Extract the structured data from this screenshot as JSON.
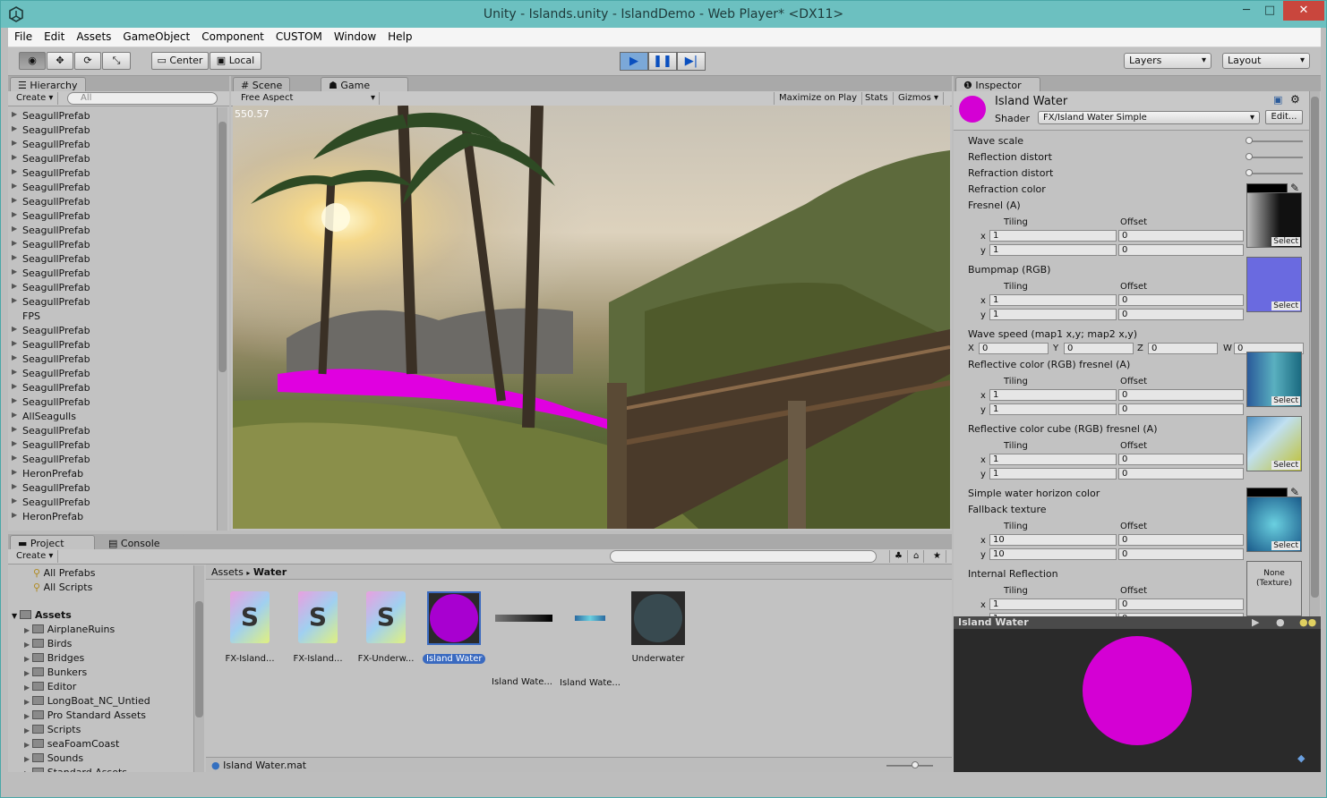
{
  "window": {
    "title": "Unity - Islands.unity - IslandDemo - Web Player* <DX11>",
    "controls": [
      "─",
      "□",
      "✕"
    ]
  },
  "menu": [
    "File",
    "Edit",
    "Assets",
    "GameObject",
    "Component",
    "CUSTOM",
    "Window",
    "Help"
  ],
  "toolbar": {
    "pivot": "Center",
    "space": "Local",
    "layers": "Layers",
    "layout": "Layout"
  },
  "hierarchy": {
    "tab": "Hierarchy",
    "create": "Create",
    "search_placeholder": "All",
    "items": [
      {
        "label": "SeagullPrefab",
        "arrow": true
      },
      {
        "label": "SeagullPrefab",
        "arrow": true
      },
      {
        "label": "SeagullPrefab",
        "arrow": true
      },
      {
        "label": "SeagullPrefab",
        "arrow": true
      },
      {
        "label": "SeagullPrefab",
        "arrow": true
      },
      {
        "label": "SeagullPrefab",
        "arrow": true
      },
      {
        "label": "SeagullPrefab",
        "arrow": true
      },
      {
        "label": "SeagullPrefab",
        "arrow": true
      },
      {
        "label": "SeagullPrefab",
        "arrow": true
      },
      {
        "label": "SeagullPrefab",
        "arrow": true
      },
      {
        "label": "SeagullPrefab",
        "arrow": true
      },
      {
        "label": "SeagullPrefab",
        "arrow": true
      },
      {
        "label": "SeagullPrefab",
        "arrow": true
      },
      {
        "label": "SeagullPrefab",
        "arrow": true
      },
      {
        "label": "FPS",
        "arrow": false
      },
      {
        "label": "SeagullPrefab",
        "arrow": true
      },
      {
        "label": "SeagullPrefab",
        "arrow": true
      },
      {
        "label": "SeagullPrefab",
        "arrow": true
      },
      {
        "label": "SeagullPrefab",
        "arrow": true
      },
      {
        "label": "SeagullPrefab",
        "arrow": true
      },
      {
        "label": "SeagullPrefab",
        "arrow": true
      },
      {
        "label": "AllSeagulls",
        "arrow": true
      },
      {
        "label": "SeagullPrefab",
        "arrow": true
      },
      {
        "label": "SeagullPrefab",
        "arrow": true
      },
      {
        "label": "SeagullPrefab",
        "arrow": true
      },
      {
        "label": "HeronPrefab",
        "arrow": true
      },
      {
        "label": "SeagullPrefab",
        "arrow": true
      },
      {
        "label": "SeagullPrefab",
        "arrow": true
      },
      {
        "label": "HeronPrefab",
        "arrow": true
      }
    ]
  },
  "scene_tab": "Scene",
  "game": {
    "tab": "Game",
    "aspect": "Free Aspect",
    "maximize": "Maximize on Play",
    "stats": "Stats",
    "gizmos": "Gizmos",
    "fps": "550.57"
  },
  "project": {
    "tab": "Project",
    "console_tab": "Console",
    "create": "Create",
    "favorites": [
      "All Prefabs",
      "All Scripts"
    ],
    "assets_root": "Assets",
    "folders": [
      "AirplaneRuins",
      "Birds",
      "Bridges",
      "Bunkers",
      "Editor",
      "LongBoat_NC_Untied",
      "Pro Standard Assets",
      "Scripts",
      "seaFoamCoast",
      "Sounds",
      "Standard Assets"
    ],
    "breadcrumb": [
      "Assets",
      "Water"
    ],
    "assets": [
      {
        "label": "FX-Island...",
        "kind": "shader"
      },
      {
        "label": "FX-Island...",
        "kind": "shader"
      },
      {
        "label": "FX-Underw...",
        "kind": "shader"
      },
      {
        "label": "Island Water",
        "kind": "material-selected"
      },
      {
        "label": "Island Wate...",
        "kind": "texture-dark"
      },
      {
        "label": "Island Wate...",
        "kind": "texture-blue"
      },
      {
        "label": "Underwater",
        "kind": "material-dark"
      }
    ],
    "status_file": "Island Water.mat"
  },
  "inspector": {
    "tab": "Inspector",
    "material_name": "Island Water",
    "shader_label": "Shader",
    "shader_value": "FX/Island Water Simple",
    "edit_button": "Edit...",
    "props": {
      "wave_scale": "Wave scale",
      "reflection_distort": "Reflection distort",
      "refraction_distort": "Refraction distort",
      "refraction_color": "Refraction color",
      "fresnel": "Fresnel (A)",
      "bumpmap": "Bumpmap (RGB)",
      "wave_speed": "Wave speed (map1 x,y; map2 x,y)",
      "reflective_color": "Reflective color (RGB) fresnel (A)",
      "reflective_cube": "Reflective color cube (RGB) fresnel (A)",
      "horizon_color": "Simple water horizon color",
      "fallback": "Fallback texture",
      "internal_reflection": "Internal Reflection"
    },
    "tiling": "Tiling",
    "offset": "Offset",
    "select": "Select",
    "x": "x",
    "y": "y",
    "wave": {
      "X": "X",
      "Y": "Y",
      "Z": "Z",
      "W": "W",
      "xv": "0",
      "yv": "0",
      "zv": "0",
      "wv": "0"
    },
    "one": "1",
    "zero": "0",
    "ten": "10",
    "none_texture_1": "None",
    "none_texture_2": "(Texture)",
    "slider_levels": {
      "wave_scale": 0.0,
      "reflection_distort": 0.0,
      "refraction_distort": 0.0
    },
    "preview_title": "Island Water"
  },
  "colors": {
    "material_magenta": "#d400d4",
    "accent_blue": "#0a4fbf"
  }
}
